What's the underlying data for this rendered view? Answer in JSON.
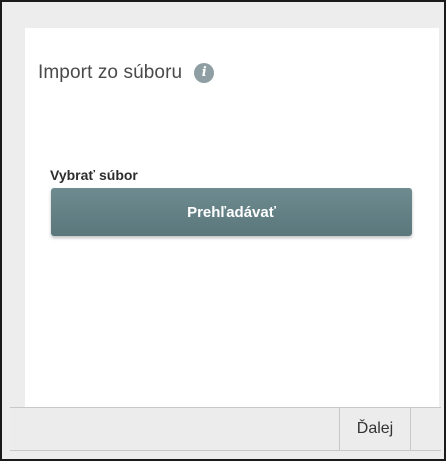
{
  "dialog": {
    "title": "Import zo súboru",
    "info_icon": "info-icon",
    "info_glyph": "i"
  },
  "file_field": {
    "label": "Vybrať súbor",
    "browse_label": "Prehľadávať"
  },
  "footer": {
    "next_label": "Ďalej"
  },
  "colors": {
    "button": "#627f84",
    "info_icon": "#8f9ea3",
    "background": "#ededed"
  }
}
